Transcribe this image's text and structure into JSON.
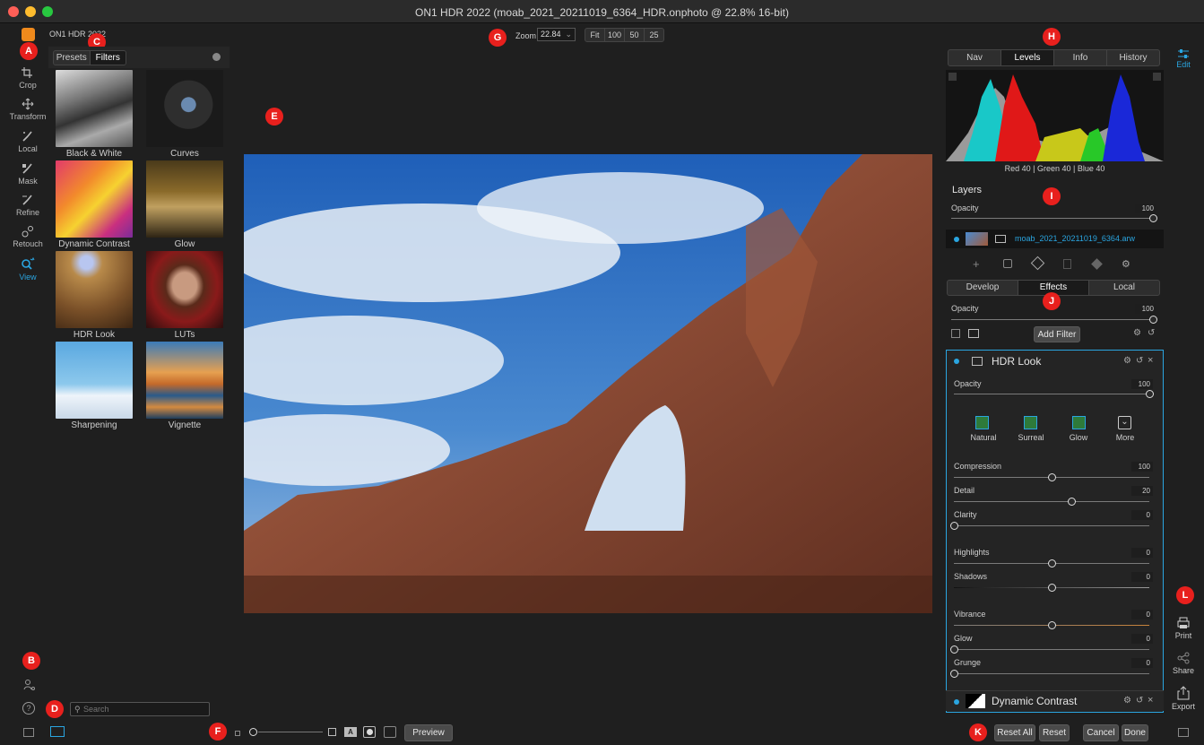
{
  "window": {
    "title": "ON1 HDR 2022 (moab_2021_20211019_6364_HDR.onphoto @ 22.8% 16-bit)"
  },
  "app_label": "ON1 HDR 2022",
  "left_tools": [
    {
      "label": "Crop",
      "icon": "crop-icon"
    },
    {
      "label": "Transform",
      "icon": "transform-icon"
    },
    {
      "label": "Local",
      "icon": "local-brush-icon"
    },
    {
      "label": "Mask",
      "icon": "mask-brush-icon"
    },
    {
      "label": "Refine",
      "icon": "refine-brush-icon"
    },
    {
      "label": "Retouch",
      "icon": "retouch-icon"
    },
    {
      "label": "View",
      "icon": "view-zoom-icon"
    }
  ],
  "browser": {
    "tabs": [
      "Presets",
      "Filters"
    ],
    "active_tab": "Filters",
    "items": [
      "Black & White",
      "Curves",
      "Dynamic Contrast",
      "Glow",
      "HDR Look",
      "LUTs",
      "Sharpening",
      "Vignette"
    ],
    "search_placeholder": "Search"
  },
  "zoom": {
    "label": "Zoom",
    "value": "22.84",
    "presets": [
      "Fit",
      "100",
      "50",
      "25"
    ]
  },
  "callouts": [
    "A",
    "B",
    "C",
    "D",
    "E",
    "F",
    "G",
    "H",
    "I",
    "J",
    "K",
    "L"
  ],
  "nav_tabs": [
    "Nav",
    "Levels",
    "Info",
    "History"
  ],
  "nav_active": "Levels",
  "levels_readout": {
    "text": "Red  40  | Green  40  | Blue  40"
  },
  "layers": {
    "title": "Layers",
    "opacity_label": "Opacity",
    "opacity_value": "100",
    "layer_name": "moab_2021_20211019_6364.arw"
  },
  "module_tabs": [
    "Develop",
    "Effects",
    "Local"
  ],
  "module_active": "Effects",
  "effects": {
    "opacity_label": "Opacity",
    "opacity_value": "100",
    "add_filter": "Add Filter"
  },
  "hdr_look": {
    "title": "HDR Look",
    "opacity_label": "Opacity",
    "opacity_value": "100",
    "styles": [
      "Natural",
      "Surreal",
      "Glow",
      "More"
    ],
    "sliders": [
      {
        "label": "Compression",
        "value": "100",
        "level": 0.5
      },
      {
        "label": "Detail",
        "value": "20",
        "level": 0.6
      },
      {
        "label": "Clarity",
        "value": "0",
        "level": 0.0
      },
      {
        "label": "Highlights",
        "value": "0",
        "level": 0.5
      },
      {
        "label": "Shadows",
        "value": "0",
        "level": 0.5
      },
      {
        "label": "Vibrance",
        "value": "0",
        "level": 0.5
      },
      {
        "label": "Glow",
        "value": "0",
        "level": 0.0
      },
      {
        "label": "Grunge",
        "value": "0",
        "level": 0.0
      }
    ]
  },
  "next_filter": {
    "title": "Dynamic Contrast"
  },
  "bottom": {
    "preview": "Preview",
    "reset_all": "Reset All",
    "reset": "Reset",
    "cancel": "Cancel",
    "done": "Done"
  },
  "right_tools": [
    {
      "label": "Edit",
      "icon": "edit-sliders-icon"
    },
    {
      "label": "Print",
      "icon": "print-icon"
    },
    {
      "label": "Share",
      "icon": "share-icon"
    },
    {
      "label": "Export",
      "icon": "export-icon"
    }
  ],
  "colors": {
    "accent": "#2aa5e0",
    "callout": "#e8201d",
    "panel": "#262626"
  }
}
